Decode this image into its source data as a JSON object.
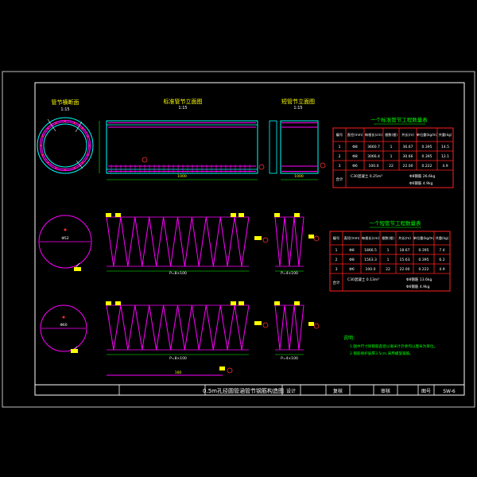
{
  "title_block": {
    "drawing_title": "0.5m孔径圆管涵管节钢筋构造图",
    "design_label": "设计",
    "review_label": "复核",
    "audit_label": "审核",
    "sheet_label": "图号",
    "sheet_no": "SW-6"
  },
  "views": {
    "section_label": "管节横断面",
    "section_scale": "1:15",
    "std_elev_label": "标准管节立面图",
    "std_elev_scale": "1:15",
    "short_elev_label": "短管节立面图",
    "short_elev_scale": "1:15",
    "std_length": "1000",
    "short_length": "1000",
    "dia_label_1": "Φ52",
    "dia_label_2": "Φ60",
    "spiral_len_1": "P=8×100",
    "spiral_len_2": "P=4×100",
    "spiral_len_3": "P=8×100",
    "spiral_len_4": "P=4×100",
    "tail_label": "160"
  },
  "table1": {
    "title": "一个标准管节工程数量表",
    "headers": [
      "编号",
      "直径(mm)",
      "每根长(cm)",
      "根数(根)",
      "共长(m)",
      "单位重(kg/m)",
      "共重(kg)"
    ],
    "rows": [
      [
        "1",
        "Φ8",
        "3660.7",
        "1",
        "36.67",
        "0.395",
        "14.5"
      ],
      [
        "2",
        "Φ8",
        "3066.4",
        "1",
        "30.66",
        "0.395",
        "12.1"
      ],
      [
        "3",
        "Φ6",
        "100.0",
        "22",
        "22.00",
        "0.222",
        "4.9"
      ]
    ],
    "total_label": "合计",
    "concrete": "C30混凝土 0.25m³",
    "steel_a": "Φ8钢筋 26.6kg",
    "steel_b": "Φ6钢筋 4.9kg"
  },
  "table2": {
    "title": "一个短管节工程数量表",
    "headers": [
      "编号",
      "直径(mm)",
      "每根长(cm)",
      "根数(根)",
      "共长(m)",
      "单位重(kg/m)",
      "共重(kg)"
    ],
    "rows": [
      [
        "1",
        "Φ8",
        "1866.5",
        "1",
        "18.67",
        "0.395",
        "7.4"
      ],
      [
        "2",
        "Φ8",
        "1563.3",
        "1",
        "15.63",
        "0.395",
        "6.2"
      ],
      [
        "3",
        "Φ6",
        "100.0",
        "22",
        "22.00",
        "0.222",
        "4.9"
      ]
    ],
    "total_label": "合计",
    "concrete": "C30混凝土 0.13m³",
    "steel_a": "Φ8钢筋 13.6kg",
    "steel_b": "Φ6钢筋 4.9kg"
  },
  "notes": {
    "heading": "说明:",
    "line1": "1.图中尺寸除钢筋直径以毫米计外余均以厘米为单位。",
    "line2": "2.钢筋保护层厚3.5cm,采用螺旋箍筋。"
  },
  "colors": {
    "background": "#000000",
    "frame": "#ffffff",
    "outline": "#00ffff",
    "rebar": "#ff00ff",
    "dimension": "#00ff00",
    "table_line": "#ff2020",
    "callout": "#ff3030",
    "label_box": "#ffff00",
    "text": "#ffffff"
  }
}
